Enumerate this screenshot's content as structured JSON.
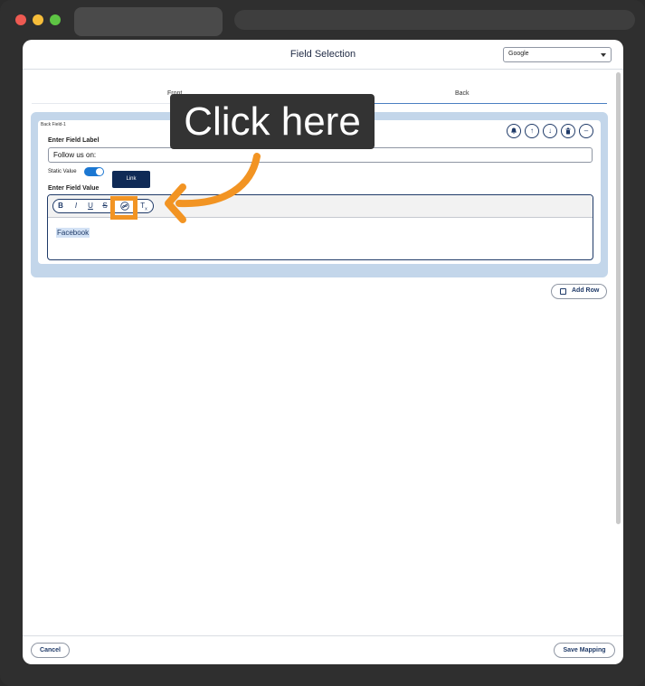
{
  "modal": {
    "title": "Field Selection",
    "source_select": "Google"
  },
  "tabs": {
    "front": "Front",
    "back": "Back"
  },
  "card": {
    "tag": "Back Field-1",
    "field_label_heading": "Enter Field Label",
    "field_label_value": "Follow us on:",
    "static_value_label": "Static Value",
    "static_value_on": true,
    "field_value_heading": "Enter Field Value",
    "editor_content": "Facebook"
  },
  "toolbar": {
    "bold": "B",
    "italic": "I",
    "underline": "U",
    "strike": "S",
    "clear": "T"
  },
  "tooltip": "Link",
  "callout": "Click here",
  "add_row_label": "Add Row",
  "footer": {
    "cancel": "Cancel",
    "save": "Save Mapping"
  },
  "colors": {
    "accent": "#1f3a68",
    "highlight": "#f29423",
    "card_bg": "#c3d6ea"
  },
  "icons": [
    "bell-icon",
    "arrow-up-icon",
    "arrow-down-icon",
    "trash-icon",
    "minus-icon",
    "link-icon",
    "copy-icon"
  ]
}
